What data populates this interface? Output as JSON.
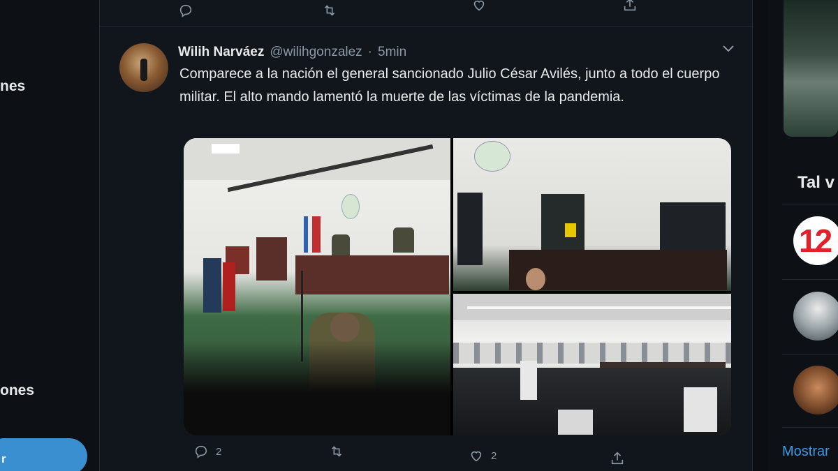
{
  "nav": {
    "item_1_label": "nes",
    "item_2_label": "ones",
    "tweet_button_label": "r"
  },
  "tweet": {
    "author_name": "Wilih Narváez",
    "handle": "@wilihgonzalez",
    "separator": "·",
    "time": "5min",
    "text": "Comparece a la nación el general sancionado Julio César Avilés, junto a todo el cuerpo militar. El alto mando lamentó la muerte de las víctimas de la pandemia.",
    "reply_count": "2",
    "retweet_count": "",
    "like_count": "2"
  },
  "sidebar": {
    "section_title": "Tal v",
    "badge_text": "12",
    "show_more": "Mostrar"
  },
  "icons": [
    "reply-icon",
    "retweet-icon",
    "like-icon",
    "share-icon",
    "chevron-down-icon"
  ],
  "colors": {
    "background": "#0b0f14",
    "timeline": "#11161c",
    "accent": "#3a9be8",
    "muted": "#8b98a5"
  }
}
